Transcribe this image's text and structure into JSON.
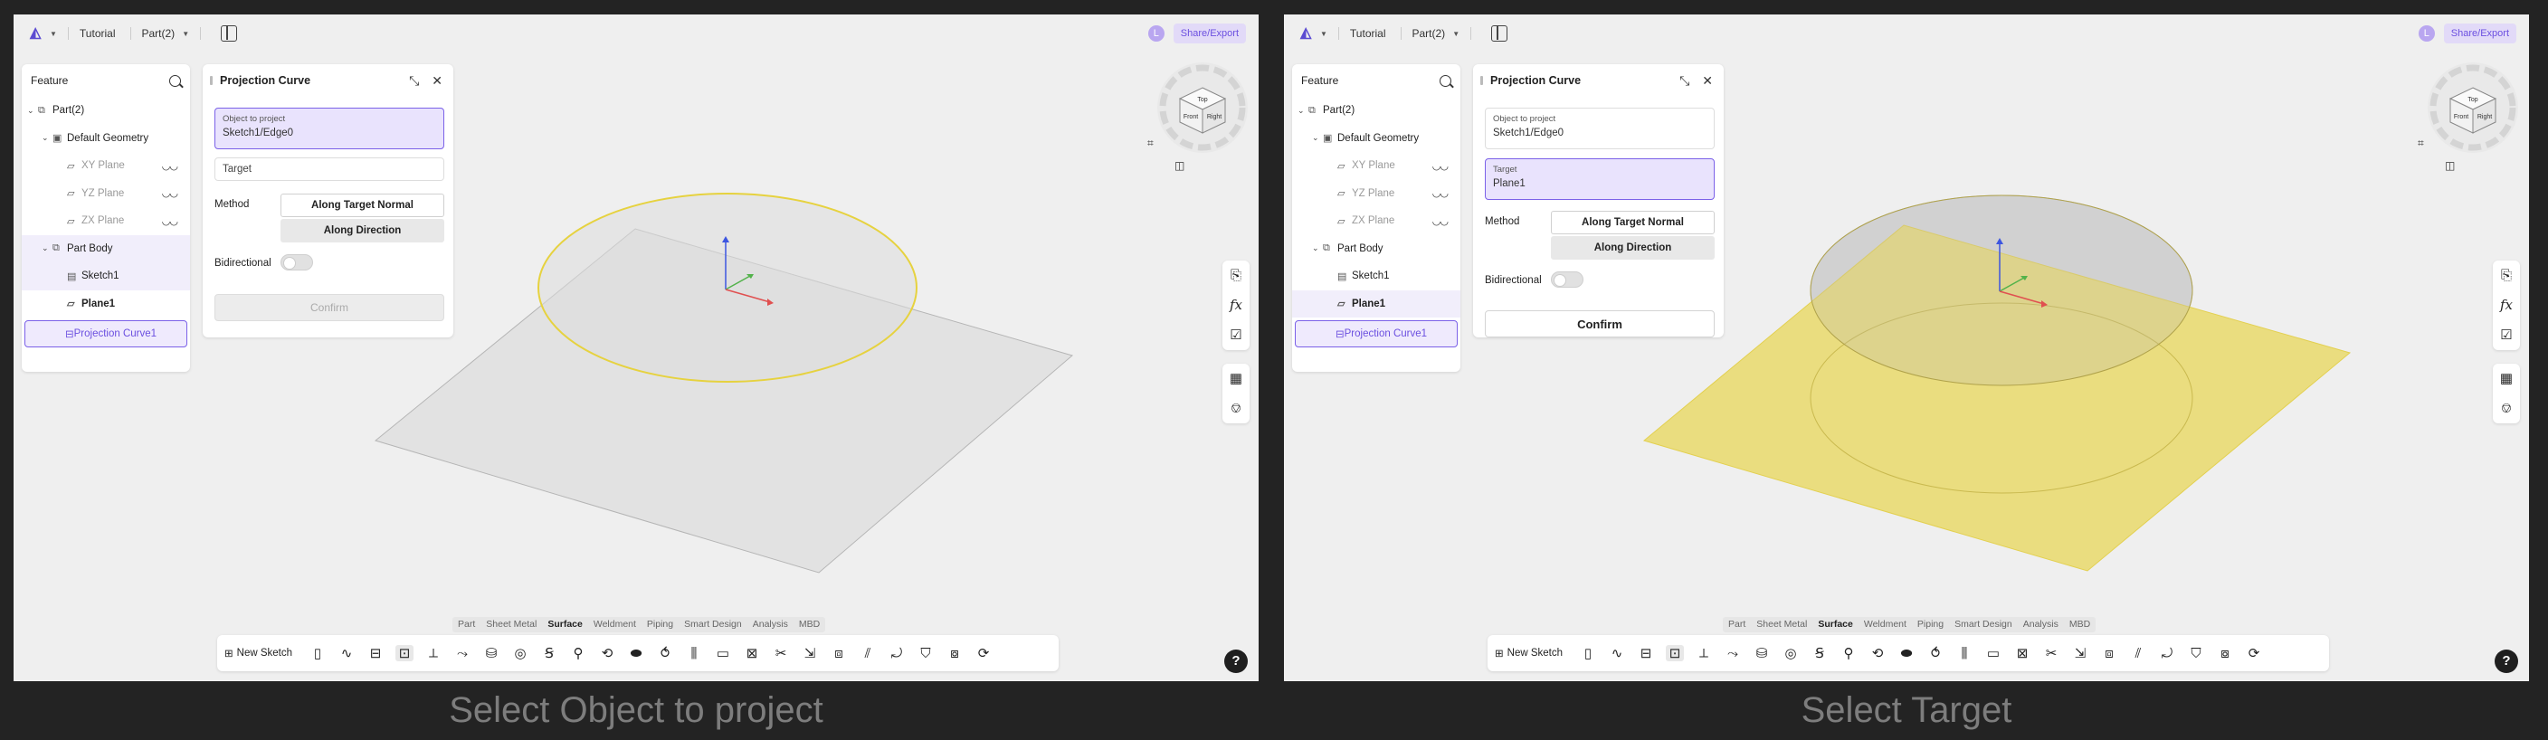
{
  "topbar": {
    "tutorial": "Tutorial",
    "part": "Part(2)",
    "avatar": "L",
    "share_export": "Share/Export"
  },
  "feature_panel": {
    "title": "Feature",
    "tree": [
      {
        "label": "Part(2)"
      },
      {
        "label": "Default Geometry"
      },
      {
        "label": "XY Plane"
      },
      {
        "label": "YZ Plane"
      },
      {
        "label": "ZX Plane"
      },
      {
        "label": "Part Body"
      },
      {
        "label": "Sketch1"
      },
      {
        "label": "Plane1"
      },
      {
        "label": "Projection Curve1"
      }
    ]
  },
  "dialog": {
    "title": "Projection Curve",
    "object_label": "Object to project",
    "object_value": "Sketch1/Edge0",
    "target_label": "Target",
    "target_value": "Plane1",
    "method_label": "Method",
    "method_options": [
      "Along Target Normal",
      "Along Direction"
    ],
    "bidirectional_label": "Bidirectional",
    "confirm_label": "Confirm"
  },
  "view_cube": {
    "faces": [
      "Front",
      "Right",
      "Top"
    ]
  },
  "module_tabs": [
    "Part",
    "Sheet Metal",
    "Surface",
    "Weldment",
    "Piping",
    "Smart Design",
    "Analysis",
    "MBD"
  ],
  "active_tab": "Surface",
  "toolbar": {
    "new_sketch": "New Sketch"
  },
  "help": "?",
  "captions": [
    "Select Object to project",
    "Select Target"
  ],
  "colors": {
    "accent": "#7b61e8",
    "circle": "#e6d23f",
    "plane_fill": "#e9db6f"
  }
}
